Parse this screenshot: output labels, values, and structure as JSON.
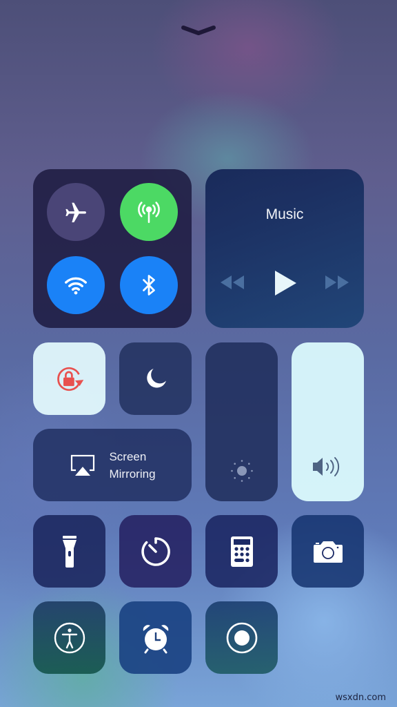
{
  "handle": {
    "icon": "chevron-down-icon"
  },
  "connectivity": {
    "airplane": {
      "icon": "airplane-icon",
      "active": false,
      "color": "#4a4577"
    },
    "cellular": {
      "icon": "antenna-icon",
      "active": true,
      "color": "#4cd964"
    },
    "wifi": {
      "icon": "wifi-icon",
      "active": true,
      "color": "#1a82f7"
    },
    "bluetooth": {
      "icon": "bluetooth-icon",
      "active": true,
      "color": "#1a82f7"
    }
  },
  "music": {
    "title": "Music",
    "controls": [
      {
        "icon": "rewind-icon",
        "enabled": false
      },
      {
        "icon": "play-icon",
        "enabled": true
      },
      {
        "icon": "fast-forward-icon",
        "enabled": false
      }
    ]
  },
  "toggles": {
    "orientation_lock": {
      "icon": "rotation-lock-icon",
      "active": true,
      "color": "#e8514f"
    },
    "do_not_disturb": {
      "icon": "moon-icon",
      "active": false
    }
  },
  "screen_mirroring": {
    "label_line1": "Screen",
    "label_line2": "Mirroring",
    "icon": "airplay-icon"
  },
  "sliders": {
    "brightness": {
      "icon": "sun-icon",
      "level": 0.0
    },
    "volume": {
      "icon": "speaker-icon",
      "level": 1.0
    }
  },
  "shortcuts": [
    {
      "name": "flashlight",
      "icon": "flashlight-icon"
    },
    {
      "name": "timer",
      "icon": "timer-icon"
    },
    {
      "name": "calculator",
      "icon": "calculator-icon"
    },
    {
      "name": "camera",
      "icon": "camera-icon"
    },
    {
      "name": "accessibility",
      "icon": "accessibility-icon"
    },
    {
      "name": "alarm",
      "icon": "alarm-clock-icon"
    },
    {
      "name": "screen-recording",
      "icon": "record-icon"
    }
  ],
  "watermark": "wsxdn.com"
}
